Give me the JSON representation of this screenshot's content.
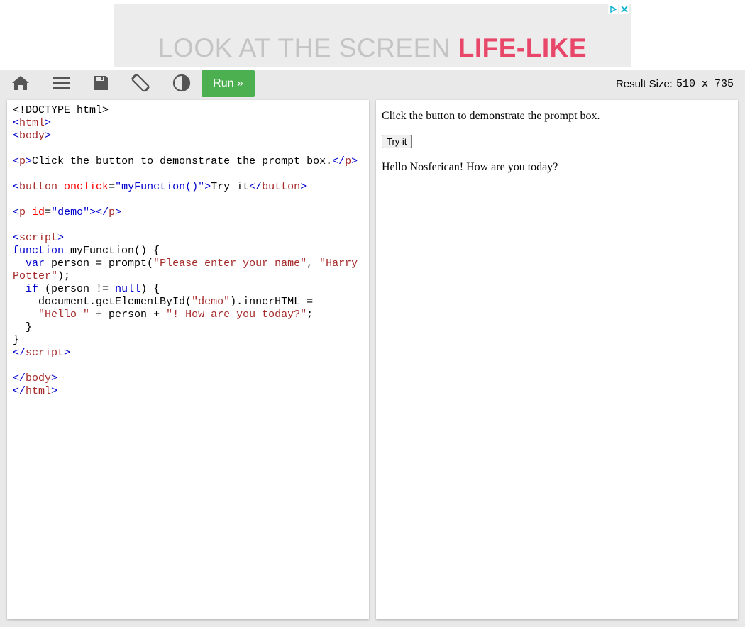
{
  "ad": {
    "text_part1": "LOOK AT THE SCREEN ",
    "text_part2": "LIFE-LIKE"
  },
  "toolbar": {
    "run_label": "Run »",
    "result_size_label": "Result Size:",
    "result_size_value": "510 x 735"
  },
  "result": {
    "intro": "Click the button to demonstrate the prompt box.",
    "button_label": "Try it",
    "demo_text": "Hello Nosferican! How are you today?"
  },
  "code": {
    "doctype": "<!DOCTYPE html>",
    "html": "html",
    "body": "body",
    "p": "p",
    "p_text": "Click the button to demonstrate the prompt box.",
    "button": "button",
    "onclick_attr": "onclick",
    "onclick_val": "\"myFunction()\"",
    "button_text": "Try it",
    "id_attr": "id",
    "id_val": "\"demo\"",
    "script": "script",
    "kw_function": "function",
    "fn_sig": " myFunction() {",
    "kw_var": "var",
    "var_line": " person = prompt(",
    "str_prompt1": "\"Please enter your name\"",
    "comma": ", ",
    "str_prompt2": "\"Harry Potter\"",
    "close_call": ");",
    "kw_if": "if",
    "if_cond": " (person != ",
    "kw_null": "null",
    "if_close": ") {",
    "doc_line": "document.getElementById(",
    "str_demo": "\"demo\"",
    "doc_line2": ").innerHTML =",
    "str_hello": "\"Hello \"",
    "concat": " + person + ",
    "str_how": "\"! How are you today?\"",
    "semicolon": ";",
    "close_brace": "}"
  }
}
